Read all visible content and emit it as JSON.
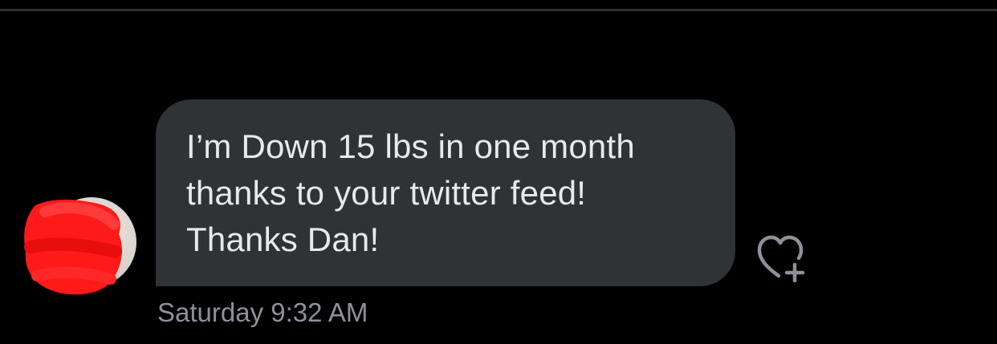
{
  "message": {
    "text": "I’m Down 15 lbs in one month\nthanks to your twitter feed!\nThanks Dan!",
    "timestamp": "Saturday 9:32 AM"
  },
  "icons": {
    "react": "heart-plus-icon",
    "avatar": "redacted-avatar"
  },
  "colors": {
    "background": "#000000",
    "bubble": "#2f3336",
    "message_text": "#e7e9ea",
    "timestamp": "#8b9298",
    "redaction": "#ff1a1a"
  }
}
